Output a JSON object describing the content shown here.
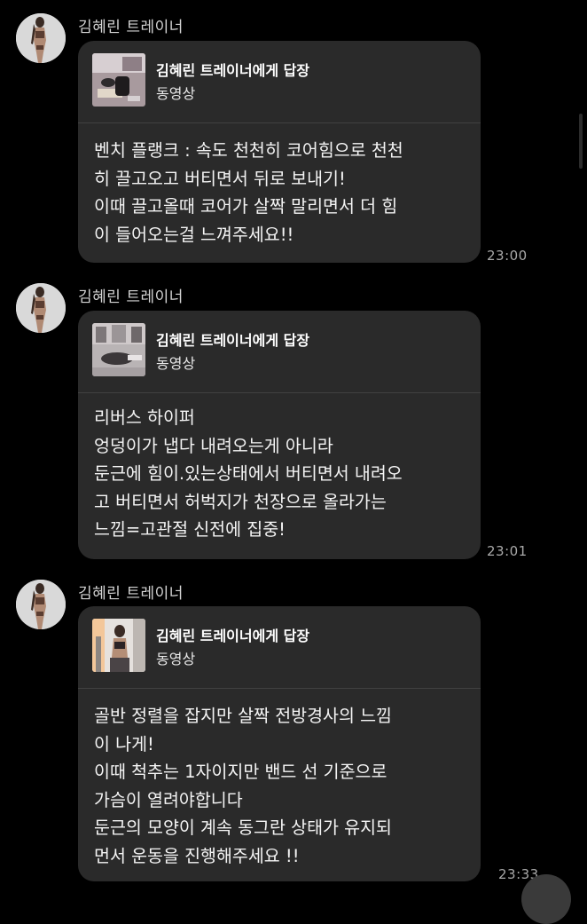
{
  "colors": {
    "background": "#000000",
    "bubble": "#2a2a2a",
    "divider": "#414141",
    "timestamp": "#a9a9a9",
    "sender": "#d4d4d4"
  },
  "messages": [
    {
      "sender": "김혜린 트레이너",
      "reply_title": "김혜린 트레이너에게 답장",
      "reply_subtitle": "동영상",
      "text": "벤치 플랭크 : 속도 천천히 코어힘으로 천천\n히 끌고오고 버티면서 뒤로 보내기!\n이때 끌고올때 코어가 살짝 말리면서 더 힘\n이 들어오는걸 느껴주세요!!",
      "time": "23:00"
    },
    {
      "sender": "김혜린 트레이너",
      "reply_title": "김혜린 트레이너에게 답장",
      "reply_subtitle": "동영상",
      "text": "리버스 하이퍼\n엉덩이가 냅다 내려오는게 아니라\n둔근에 힘이.있는상태에서 버티면서 내려오\n고 버티면서 허벅지가 천장으로 올라가는\n느낌=고관절 신전에 집중!",
      "time": "23:01"
    },
    {
      "sender": "김혜린 트레이너",
      "reply_title": "김혜린 트레이너에게 답장",
      "reply_subtitle": "동영상",
      "text": "골반 정렬을 잡지만 살짝 전방경사의 느낌\n이 나게!\n이때 척추는 1자이지만 밴드 선 기준으로\n가슴이 열려야합니다\n둔근의 모양이 계속 동그란 상태가 유지되\n먼서 운동을 진행해주세요 !!",
      "time": "23:33"
    }
  ]
}
